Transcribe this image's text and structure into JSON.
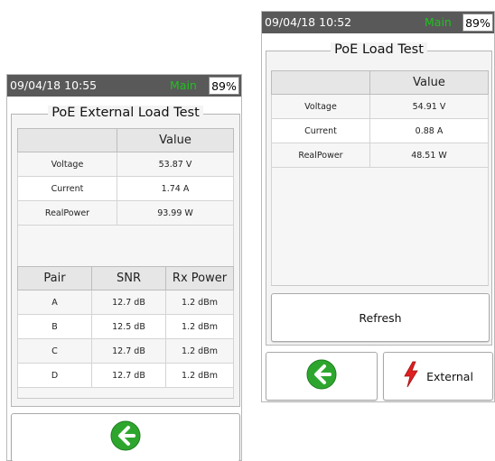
{
  "left_screen": {
    "status": {
      "time": "09/04/18 10:55",
      "mode": "Main",
      "battery": "89%"
    },
    "title": "PoE External Load Test",
    "measurements": {
      "header": [
        "",
        "Value"
      ],
      "rows": [
        {
          "label": "Voltage",
          "value": "53.87 V"
        },
        {
          "label": "Current",
          "value": "1.74 A"
        },
        {
          "label": "RealPower",
          "value": "93.99 W"
        }
      ]
    },
    "pairs": {
      "header": [
        "Pair",
        "SNR",
        "Rx Power"
      ],
      "rows": [
        {
          "pair": "A",
          "snr": "12.7 dB",
          "rx": "1.2 dBm"
        },
        {
          "pair": "B",
          "snr": "12.5 dB",
          "rx": "1.2 dBm"
        },
        {
          "pair": "C",
          "snr": "12.7 dB",
          "rx": "1.2 dBm"
        },
        {
          "pair": "D",
          "snr": "12.7 dB",
          "rx": "1.2 dBm"
        }
      ]
    },
    "back_icon": "back-arrow-icon"
  },
  "right_screen": {
    "status": {
      "time": "09/04/18 10:52",
      "mode": "Main",
      "battery": "89%"
    },
    "title": "PoE Load Test",
    "measurements": {
      "header": [
        "",
        "Value"
      ],
      "rows": [
        {
          "label": "Voltage",
          "value": "54.91 V"
        },
        {
          "label": "Current",
          "value": "0.88 A"
        },
        {
          "label": "RealPower",
          "value": "48.51 W"
        }
      ]
    },
    "refresh_label": "Refresh",
    "external_label": "External",
    "back_icon": "back-arrow-icon",
    "external_icon": "lightning-icon"
  },
  "colors": {
    "status_bg": "#595959",
    "mode_green": "#20c020",
    "icon_green": "#2ea62e",
    "bolt_red": "#e02020"
  }
}
